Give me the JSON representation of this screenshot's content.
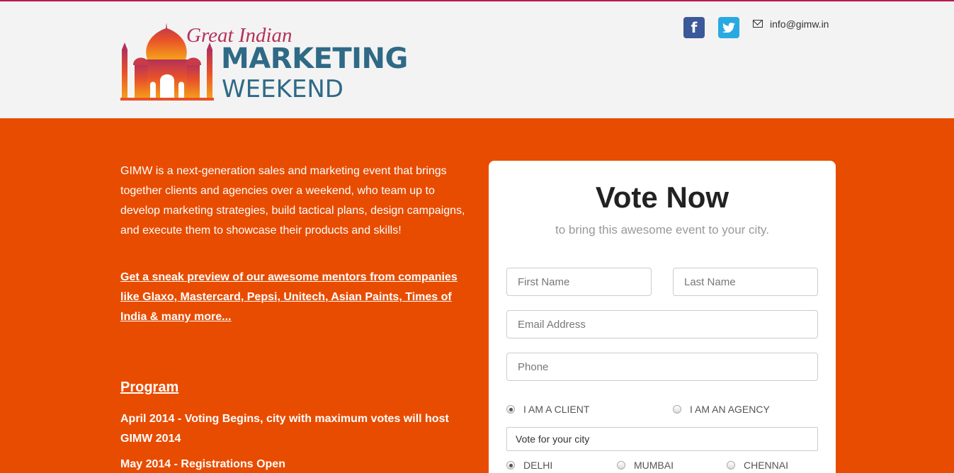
{
  "header": {
    "logo_line1": "Great Indian",
    "logo_line2": "MARKETING",
    "logo_line3": "WEEKEND",
    "facebook_icon": "f",
    "twitter_icon": "🐦",
    "email": "info@gimw.in"
  },
  "intro": {
    "text": "GIMW is a next-generation sales and marketing event that brings together clients and agencies over a weekend, who team up to develop marketing strategies, build tactical plans, design campaigns, and execute them to showcase their products and skills!",
    "sneak_link": "Get a sneak preview of our awesome mentors from companies like Glaxo, Mastercard, Pepsi, Unitech, Asian Paints, Times of India & many more..."
  },
  "program": {
    "title": "Program",
    "items": [
      "April 2014 - Voting Begins, city with maximum votes will host GIMW 2014",
      "May 2014 - Registrations Open"
    ]
  },
  "form": {
    "title": "Vote Now",
    "subtitle": "to bring this awesome event to your city.",
    "first_name_placeholder": "First Name",
    "last_name_placeholder": "Last Name",
    "email_placeholder": "Email Address",
    "phone_placeholder": "Phone",
    "client_label": "I AM A CLIENT",
    "agency_label": "I AM AN AGENCY",
    "city_select": "Vote for your city",
    "cities": [
      "DELHI",
      "MUMBAI",
      "CHENNAI"
    ]
  },
  "colors": {
    "brand_orange": "#e84c00",
    "brand_blue": "#2e6a86",
    "brand_magenta": "#b3315a"
  }
}
